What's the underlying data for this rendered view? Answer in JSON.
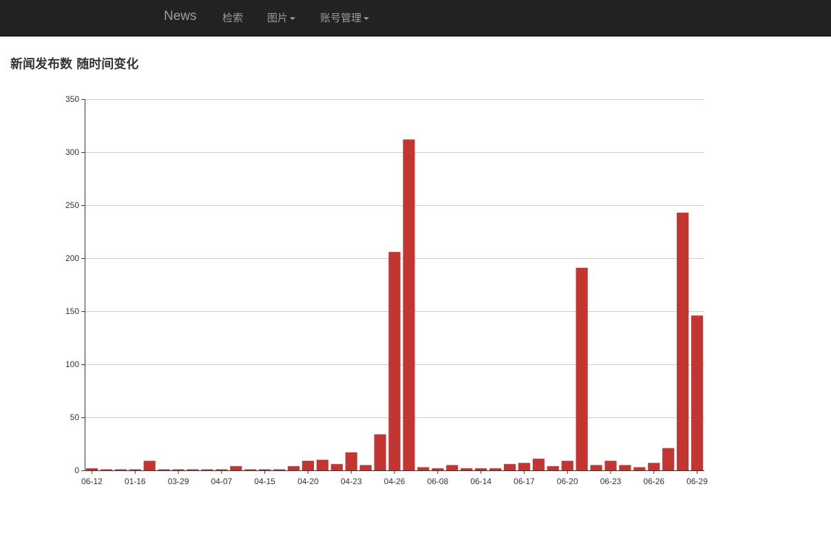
{
  "navbar": {
    "brand": "News",
    "items": [
      {
        "label": "检索",
        "dropdown": false
      },
      {
        "label": "图片",
        "dropdown": true
      },
      {
        "label": "账号管理",
        "dropdown": true
      }
    ]
  },
  "page": {
    "title": "新闻发布数 随时间变化"
  },
  "colors": {
    "bar": "#c23531",
    "navbar_bg": "#222222",
    "nav_text": "#9d9d9d",
    "grid": "#cccccc",
    "axis": "#333333"
  },
  "chart_data": {
    "type": "bar",
    "title": "",
    "xlabel": "",
    "ylabel": "",
    "ylim": [
      0,
      350
    ],
    "yticks": [
      0,
      50,
      100,
      150,
      200,
      250,
      300,
      350
    ],
    "grid": true,
    "xtick_labels": [
      "06-12",
      "01-16",
      "03-29",
      "04-07",
      "04-15",
      "04-20",
      "04-23",
      "04-26",
      "06-08",
      "06-14",
      "06-17",
      "06-20",
      "06-23",
      "06-26",
      "06-29"
    ],
    "xtick_every": 3,
    "values": [
      2,
      1,
      1,
      1,
      9,
      1,
      1,
      1,
      1,
      1,
      4,
      1,
      1,
      1,
      4,
      9,
      10,
      6,
      17,
      5,
      34,
      206,
      312,
      3,
      2,
      5,
      2,
      2,
      2,
      6,
      7,
      11,
      4,
      9,
      191,
      5,
      9,
      5,
      3,
      7,
      21,
      243,
      146
    ]
  }
}
